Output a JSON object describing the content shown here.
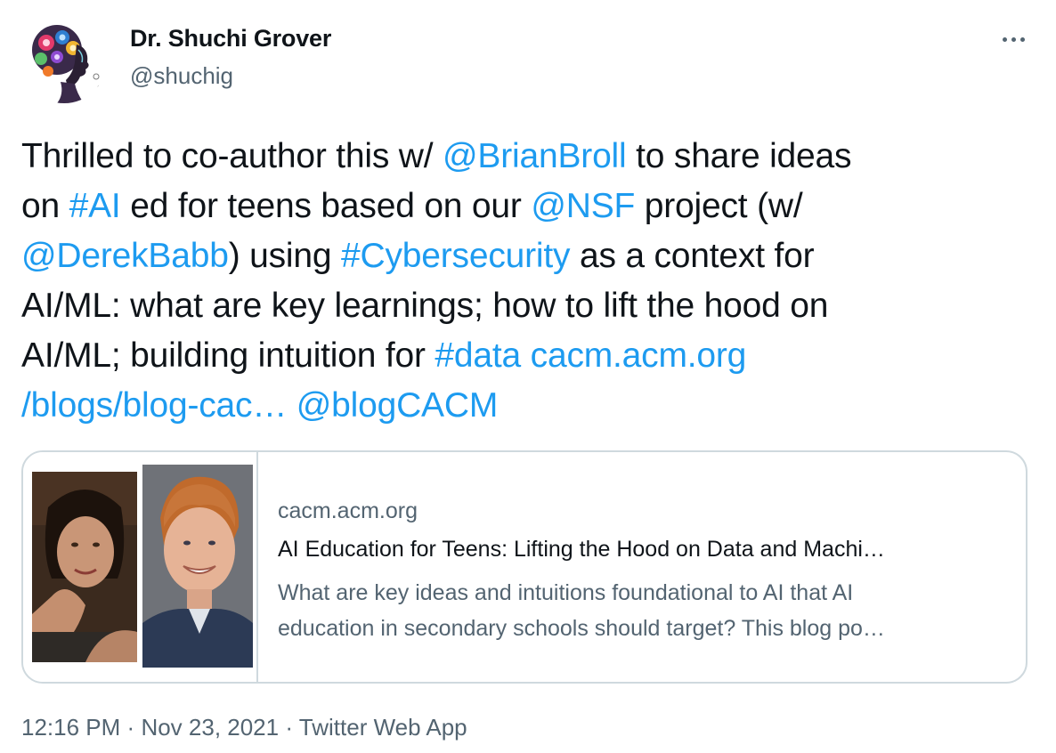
{
  "author": {
    "name": "Dr. Shuchi Grover",
    "handle": "@shuchig",
    "avatar_icon": "swirl-portrait-avatar"
  },
  "menu": {
    "more_icon": "more-horizontal-icon"
  },
  "tweet": {
    "lines": [
      [
        {
          "text": "Thrilled to co-author this w/ ",
          "type": "text"
        },
        {
          "text": "@BrianBroll",
          "type": "mention"
        },
        {
          "text": " to share ideas",
          "type": "text"
        }
      ],
      [
        {
          "text": "on ",
          "type": "text"
        },
        {
          "text": "#AI",
          "type": "hashtag"
        },
        {
          "text": " ed for teens based on our ",
          "type": "text"
        },
        {
          "text": "@NSF",
          "type": "mention"
        },
        {
          "text": " project (w/",
          "type": "text"
        }
      ],
      [
        {
          "text": "@DerekBabb",
          "type": "mention"
        },
        {
          "text": ") using ",
          "type": "text"
        },
        {
          "text": "#Cybersecurity",
          "type": "hashtag"
        },
        {
          "text": " as a context for",
          "type": "text"
        }
      ],
      [
        {
          "text": "AI/ML: what are key learnings; how to lift the hood on",
          "type": "text"
        }
      ],
      [
        {
          "text": "AI/ML; building intuition for ",
          "type": "text"
        },
        {
          "text": "#data",
          "type": "hashtag"
        },
        {
          "text": " ",
          "type": "text"
        },
        {
          "text": "cacm.acm.org",
          "type": "url"
        }
      ],
      [
        {
          "text": "/blogs/blog-cac…",
          "type": "url"
        },
        {
          "text": " ",
          "type": "text"
        },
        {
          "text": "@blogCACM",
          "type": "mention"
        }
      ]
    ]
  },
  "card": {
    "domain": "cacm.acm.org",
    "title": "AI Education for Teens: Lifting the Hood on Data and Machi…",
    "description_lines": [
      "What are key ideas and intuitions foundational to AI that AI",
      "education in secondary schools should target? This blog po…"
    ]
  },
  "meta": {
    "time": "12:16 PM",
    "separator": "·",
    "date": "Nov 23, 2021",
    "source": "Twitter Web App"
  },
  "colors": {
    "link": "#1d9bf0",
    "secondary_text": "#536471",
    "primary_text": "#0f1419",
    "border": "#cfd9de"
  }
}
